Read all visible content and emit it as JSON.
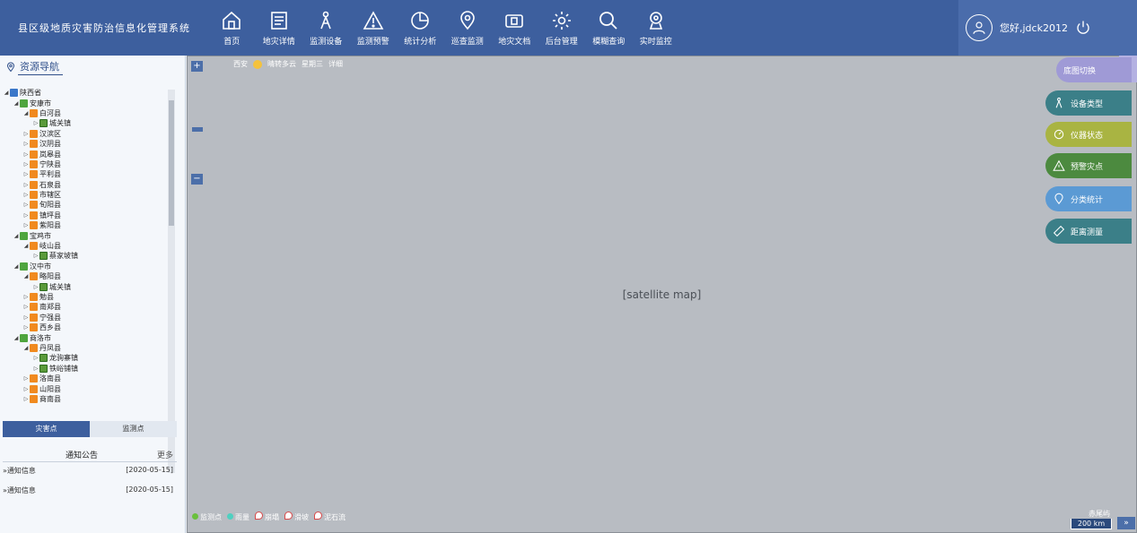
{
  "header": {
    "title": "县区级地质灾害防治信息化管理系统",
    "nav": [
      {
        "label": "首页",
        "icon": "home-icon"
      },
      {
        "label": "地灾详情",
        "icon": "document-icon"
      },
      {
        "label": "监测设备",
        "icon": "device-icon"
      },
      {
        "label": "监测预警",
        "icon": "warning-icon"
      },
      {
        "label": "统计分析",
        "icon": "pie-chart-icon"
      },
      {
        "label": "巡查监测",
        "icon": "location-icon"
      },
      {
        "label": "地灾文档",
        "icon": "folder-icon"
      },
      {
        "label": "后台管理",
        "icon": "gear-icon"
      },
      {
        "label": "模糊查询",
        "icon": "search-icon"
      },
      {
        "label": "实时监控",
        "icon": "camera-icon"
      }
    ],
    "user_greeting": "您好,jdck2012"
  },
  "sidebar": {
    "title": "资源导航",
    "tree": [
      {
        "label": "陕西省",
        "level": 0,
        "type": "prov",
        "arrow": "◢"
      },
      {
        "label": "安康市",
        "level": 1,
        "type": "city",
        "arrow": "◢"
      },
      {
        "label": "白河县",
        "level": 2,
        "type": "county",
        "arrow": "◢"
      },
      {
        "label": "城关镇",
        "level": 3,
        "type": "town",
        "arrow": "▷"
      },
      {
        "label": "汉滨区",
        "level": 2,
        "type": "county",
        "arrow": "▷"
      },
      {
        "label": "汉阴县",
        "level": 2,
        "type": "county",
        "arrow": "▷"
      },
      {
        "label": "岚皋县",
        "level": 2,
        "type": "county",
        "arrow": "▷"
      },
      {
        "label": "宁陕县",
        "level": 2,
        "type": "county",
        "arrow": "▷"
      },
      {
        "label": "平利县",
        "level": 2,
        "type": "county",
        "arrow": "▷"
      },
      {
        "label": "石泉县",
        "level": 2,
        "type": "county",
        "arrow": "▷"
      },
      {
        "label": "市辖区",
        "level": 2,
        "type": "county",
        "arrow": "▷"
      },
      {
        "label": "旬阳县",
        "level": 2,
        "type": "county",
        "arrow": "▷"
      },
      {
        "label": "镇坪县",
        "level": 2,
        "type": "county",
        "arrow": "▷"
      },
      {
        "label": "紫阳县",
        "level": 2,
        "type": "county",
        "arrow": "▷"
      },
      {
        "label": "宝鸡市",
        "level": 1,
        "type": "city",
        "arrow": "◢"
      },
      {
        "label": "岐山县",
        "level": 2,
        "type": "county",
        "arrow": "◢"
      },
      {
        "label": "蔡家坡镇",
        "level": 3,
        "type": "town",
        "arrow": "▷"
      },
      {
        "label": "汉中市",
        "level": 1,
        "type": "city",
        "arrow": "◢"
      },
      {
        "label": "略阳县",
        "level": 2,
        "type": "county",
        "arrow": "◢"
      },
      {
        "label": "城关镇",
        "level": 3,
        "type": "town",
        "arrow": "▷"
      },
      {
        "label": "勉县",
        "level": 2,
        "type": "county",
        "arrow": "▷"
      },
      {
        "label": "南郑县",
        "level": 2,
        "type": "county",
        "arrow": "▷"
      },
      {
        "label": "宁强县",
        "level": 2,
        "type": "county",
        "arrow": "▷"
      },
      {
        "label": "西乡县",
        "level": 2,
        "type": "county",
        "arrow": "▷"
      },
      {
        "label": "商洛市",
        "level": 1,
        "type": "city",
        "arrow": "◢"
      },
      {
        "label": "丹凤县",
        "level": 2,
        "type": "county",
        "arrow": "◢"
      },
      {
        "label": "龙驹寨镇",
        "level": 3,
        "type": "town",
        "arrow": "▷"
      },
      {
        "label": "铁峪铺镇",
        "level": 3,
        "type": "town",
        "arrow": "▷"
      },
      {
        "label": "洛南县",
        "level": 2,
        "type": "county",
        "arrow": "▷"
      },
      {
        "label": "山阳县",
        "level": 2,
        "type": "county",
        "arrow": "▷"
      },
      {
        "label": "商南县",
        "level": 2,
        "type": "county",
        "arrow": "▷"
      }
    ],
    "tabs": [
      "灾害点",
      "监测点"
    ],
    "notice": {
      "title": "通知公告",
      "more": "更多",
      "items": [
        {
          "title": "通知信息",
          "date": "[2020-05-15]"
        },
        {
          "title": "通知信息",
          "date": "[2020-05-15]"
        }
      ]
    }
  },
  "map": {
    "weather": {
      "city": "西安",
      "desc": "晴转多云",
      "day": "星期三",
      "detail": "详细"
    },
    "tools": [
      "底图切换",
      "设备类型",
      "仪器状态",
      "预警灾点",
      "分类统计",
      "距离测量"
    ],
    "legend": [
      "监测点",
      "雨量",
      "崩塌",
      "滑坡",
      "泥石流"
    ],
    "scale": "200 km",
    "scale_label": "赤尾屿",
    "placeholder_label": "[satellite map]"
  },
  "colors": {
    "header": "#3d5f9e",
    "tool_purple": "#9f9ad6",
    "tool_teal": "#3b7f88",
    "tool_olive": "#a9b442"
  }
}
